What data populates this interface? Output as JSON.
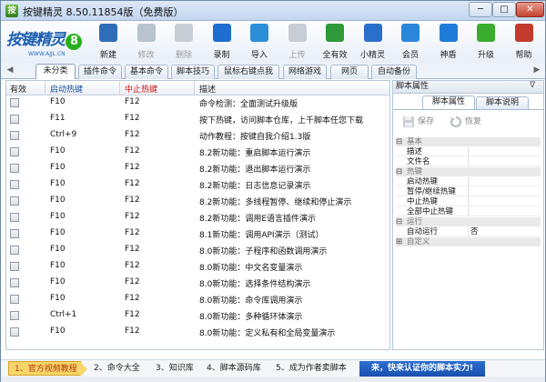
{
  "window": {
    "app_icon_text": "按",
    "title": "按键精灵 8.50.11854版（免费版）",
    "min_label": "─",
    "max_label": "□",
    "close_label": "✕"
  },
  "logo": {
    "text": "按键精灵",
    "digit": "8",
    "url_text": "WWW.AJJL.CN"
  },
  "toolbar": [
    {
      "label": "新建",
      "icon": "new-icon",
      "color": "#2f6db8"
    },
    {
      "label": "修改",
      "icon": "edit-icon",
      "color": "#b8c3cf",
      "disabled": true
    },
    {
      "label": "删除",
      "icon": "delete-icon",
      "color": "#c7cdd5",
      "disabled": true
    },
    {
      "label": "录制",
      "icon": "record-icon",
      "color": "#1f6dd1"
    },
    {
      "label": "导入",
      "icon": "import-icon",
      "color": "#2a8fd6"
    },
    {
      "label": "上传",
      "icon": "upload-icon",
      "color": "#c7cdd5",
      "disabled": true
    },
    {
      "label": "全有效",
      "icon": "all-valid-icon",
      "color": "#2f9a3a"
    },
    {
      "label": "小精灵",
      "icon": "sprite-icon",
      "color": "#2b6fcc"
    },
    {
      "label": "会员",
      "icon": "member-icon",
      "color": "#2a86d9"
    },
    {
      "label": "神盾",
      "icon": "shield-icon",
      "color": "#1f7bd8"
    },
    {
      "label": "升级",
      "icon": "upgrade-icon",
      "color": "#3bad2e"
    },
    {
      "label": "帮助",
      "icon": "help-icon",
      "color": "#c23b2c"
    }
  ],
  "tabs": [
    "未分类",
    "插件命令",
    "基本命令",
    "脚本技巧",
    "鼠标右键点我",
    "网络游戏",
    "网页",
    "自动备份"
  ],
  "tab_arrows": {
    "left": "◀",
    "right": "▶"
  },
  "grid": {
    "headers": {
      "valid": "有效",
      "start": "启动热键",
      "stop": "中止热键",
      "desc": "描述"
    },
    "rows": [
      {
        "start": "F10",
        "stop": "F12",
        "desc": "命令检测：全面测试升级版"
      },
      {
        "start": "F11",
        "stop": "F12",
        "desc": "按下热键，访问脚本仓库，上千脚本任您下载"
      },
      {
        "start": "Ctrl+9",
        "stop": "F12",
        "desc": "动作教程：按键自我介绍1.3版"
      },
      {
        "start": "F10",
        "stop": "F12",
        "desc": "8.2新功能：重启脚本运行演示"
      },
      {
        "start": "F10",
        "stop": "F12",
        "desc": "8.2新功能：退出脚本运行演示"
      },
      {
        "start": "F10",
        "stop": "F12",
        "desc": "8.2新功能：日志信息记录演示"
      },
      {
        "start": "F10",
        "stop": "F12",
        "desc": "8.2新功能：多线程暂停、继续和停止演示"
      },
      {
        "start": "F10",
        "stop": "F12",
        "desc": "8.2新功能：调用E语言插件演示"
      },
      {
        "start": "F10",
        "stop": "F12",
        "desc": "8.1新功能：调用API演示（测试）"
      },
      {
        "start": "F10",
        "stop": "F12",
        "desc": "8.0新功能：子程序和函数调用演示"
      },
      {
        "start": "F10",
        "stop": "F12",
        "desc": "8.0新功能：中文名变量演示"
      },
      {
        "start": "F10",
        "stop": "F12",
        "desc": "8.0新功能：选择条件结构演示"
      },
      {
        "start": "F10",
        "stop": "F12",
        "desc": "8.0新功能：命令库调用演示"
      },
      {
        "start": "Ctrl+1",
        "stop": "F12",
        "desc": "8.0新功能：多种循环体演示"
      },
      {
        "start": "F10",
        "stop": "F12",
        "desc": "8.0新功能：定义私有和全局变量演示"
      }
    ]
  },
  "side": {
    "title": "脚本属性",
    "pin": "ᐁ",
    "tabs": [
      "脚本属性",
      "脚本说明"
    ],
    "save_label": "保存",
    "restore_label": "恢复",
    "tree_toggle_open": "⊟",
    "tree_toggle_closed": "⊞",
    "categories": [
      {
        "name": "基本",
        "open": true,
        "items": [
          {
            "key": "描述",
            "value": ""
          },
          {
            "key": "文件名",
            "value": ""
          }
        ]
      },
      {
        "name": "热键",
        "open": true,
        "items": [
          {
            "key": "启动热键",
            "value": ""
          },
          {
            "key": "暂停/继续热键",
            "value": ""
          },
          {
            "key": "中止热键",
            "value": ""
          },
          {
            "key": "全部中止热键",
            "value": ""
          }
        ]
      },
      {
        "name": "运行",
        "open": true,
        "items": [
          {
            "key": "自动运行",
            "value": "否"
          }
        ]
      },
      {
        "name": "自定义",
        "open": false,
        "items": []
      }
    ]
  },
  "bottom_links": [
    "1、官方视频教程",
    "2、命令大全",
    "3、知识库",
    "4、脚本源码库",
    "5、成为作者卖脚本"
  ],
  "banner_text": "来，快来认证你的脚本实力!",
  "colors": {
    "stop_header": "#cc1111",
    "start_header": "#1a4f9e",
    "banner": "#2d6fd0"
  }
}
